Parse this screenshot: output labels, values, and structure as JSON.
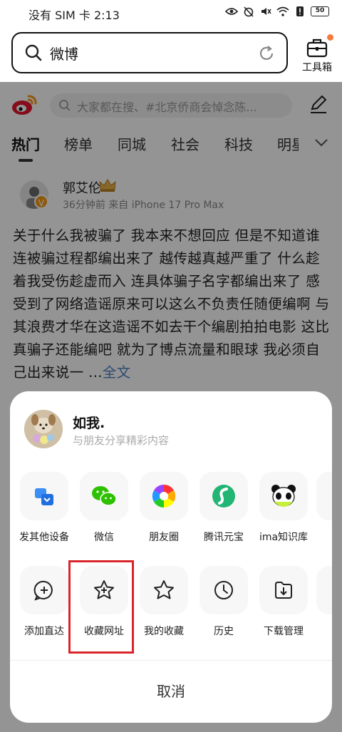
{
  "status_bar": {
    "carrier_time": "没有 SIM 卡 2:13",
    "battery": "50"
  },
  "browser": {
    "search_query": "微博",
    "toolbox_label": "工具箱"
  },
  "weibo": {
    "search_placeholder": "大家都在搜、#北京侨商会悼念陈...",
    "tabs": [
      "热门",
      "榜单",
      "同城",
      "社会",
      "科技",
      "明星"
    ],
    "post": {
      "author": "郭艾伦",
      "meta": "36分钟前 来自 iPhone 17 Pro Max",
      "text": "关于什么我被骗了 我本来不想回应 但是不知道谁连被骗过程都编出来了 越传越真越严重了 什么趁着我受伤趁虚而入 连具体骗子名字都编出来了 感受到了网络造谣原来可以这么不负责任随便编啊 与其浪费才华在这造谣不如去干个编剧拍拍电影 这比真骗子还能编吧 就为了博点流量和眼球 我必须自己出来说一 ...",
      "more": "全文"
    }
  },
  "share_sheet": {
    "profile": {
      "name": "如我.",
      "subtitle": "与朋友分享精彩内容"
    },
    "share_row": [
      {
        "label": "发其他设备",
        "icon": "send-to-device-icon"
      },
      {
        "label": "微信",
        "icon": "wechat-icon"
      },
      {
        "label": "朋友圈",
        "icon": "moments-icon"
      },
      {
        "label": "腾讯元宝",
        "icon": "yuanbao-icon"
      },
      {
        "label": "ima知识库",
        "icon": "ima-panda-icon"
      }
    ],
    "action_row": [
      {
        "label": "添加直达",
        "icon": "add-shortcut-icon"
      },
      {
        "label": "收藏网址",
        "icon": "bookmark-add-icon"
      },
      {
        "label": "我的收藏",
        "icon": "star-icon"
      },
      {
        "label": "历史",
        "icon": "clock-icon"
      },
      {
        "label": "下载管理",
        "icon": "download-icon"
      }
    ],
    "cancel": "取消"
  },
  "colors": {
    "highlight": "#d9262c",
    "weibo_red": "#e6162d",
    "link": "#4a7fc1"
  }
}
